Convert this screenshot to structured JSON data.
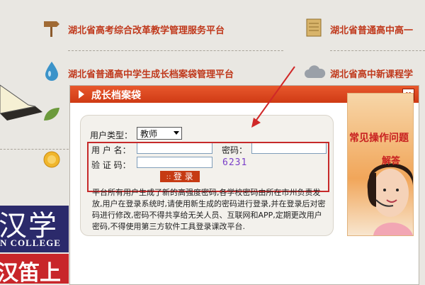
{
  "background": {
    "links": [
      {
        "label": "湖北省高考综合改革教学管理服务平台",
        "icon": "signpost-icon"
      },
      {
        "label": "湖北省普通高中高一",
        "icon": "notepad-icon"
      },
      {
        "label": "湖北省普通高中学生成长档案袋管理平台",
        "icon": "water-drop-icon"
      },
      {
        "label": "湖北省高中新课程学",
        "icon": "cloud-icon"
      }
    ],
    "banner_big": "汉学院",
    "banner_small": "N COLLEGE",
    "banner_red": "汉笛上"
  },
  "modal": {
    "title": "成长档案袋",
    "close_label": "x",
    "user_type_label": "用户类型：",
    "user_type_value": "教师",
    "username_label": "用 户 名：",
    "password_label": "密码：",
    "captcha_label": "验 证 码：",
    "captcha_code": "6231",
    "login_label": "登 录",
    "notice": "平台所有用户生成了新的高强度密码,各学校密码由所在市州负责发放,用户在登录系统时,请使用新生成的密码进行登录,并在登录后对密码进行修改,密码不得共享给无关人员、互联网和APP,定期更改用户密码,不得使用第三方软件工具登录课改平台.",
    "help_line1": "常见操作问题",
    "help_line2": "解答"
  },
  "colors": {
    "accent": "#c63a13",
    "title_bar": "#e04a22",
    "highlight": "#c62a2a"
  }
}
